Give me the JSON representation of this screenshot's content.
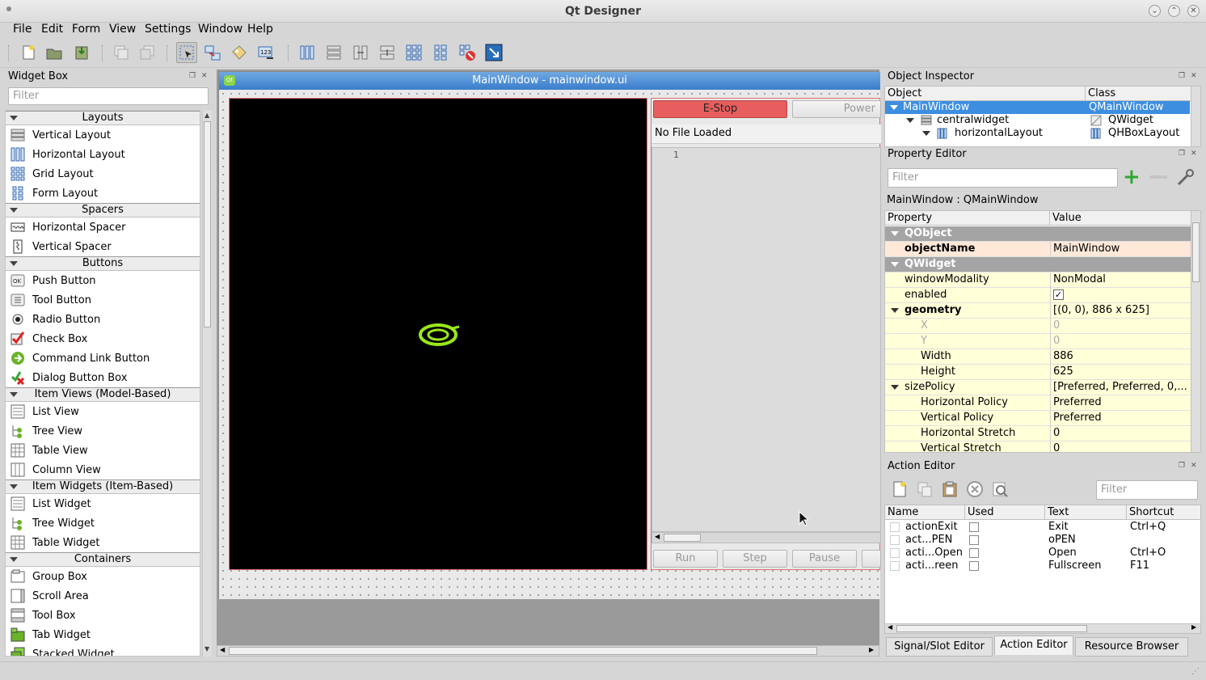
{
  "app_title": "Qt Designer",
  "menu": [
    "File",
    "Edit",
    "Form",
    "View",
    "Settings",
    "Window",
    "Help"
  ],
  "widget_box": {
    "title": "Widget Box",
    "filter_placeholder": "Filter",
    "categories": [
      {
        "name": "Layouts",
        "items": [
          "Vertical Layout",
          "Horizontal Layout",
          "Grid Layout",
          "Form Layout"
        ]
      },
      {
        "name": "Spacers",
        "items": [
          "Horizontal Spacer",
          "Vertical Spacer"
        ]
      },
      {
        "name": "Buttons",
        "items": [
          "Push Button",
          "Tool Button",
          "Radio Button",
          "Check Box",
          "Command Link Button",
          "Dialog Button Box"
        ]
      },
      {
        "name": "Item Views (Model-Based)",
        "items": [
          "List View",
          "Tree View",
          "Table View",
          "Column View"
        ]
      },
      {
        "name": "Item Widgets (Item-Based)",
        "items": [
          "List Widget",
          "Tree Widget",
          "Table Widget"
        ]
      },
      {
        "name": "Containers",
        "items": [
          "Group Box",
          "Scroll Area",
          "Tool Box",
          "Tab Widget",
          "Stacked Widget"
        ]
      }
    ]
  },
  "form": {
    "window_title": "MainWindow - mainwindow.ui",
    "estop_label": "E-Stop",
    "power_label": "Power",
    "file_status": "No File Loaded",
    "line_number": "1",
    "run_label": "Run",
    "step_label": "Step",
    "pause_label": "Pause"
  },
  "object_inspector": {
    "title": "Object Inspector",
    "col_object": "Object",
    "col_class": "Class",
    "rows": [
      {
        "object": "MainWindow",
        "class": "QMainWindow"
      },
      {
        "object": "centralwidget",
        "class": "QWidget"
      },
      {
        "object": "horizontalLayout",
        "class": "QHBoxLayout"
      }
    ]
  },
  "property_editor": {
    "title": "Property Editor",
    "filter_placeholder": "Filter",
    "context": "MainWindow : QMainWindow",
    "col_property": "Property",
    "col_value": "Value",
    "rows": [
      {
        "k": "QObject",
        "v": ""
      },
      {
        "k": "objectName",
        "v": "MainWindow"
      },
      {
        "k": "QWidget",
        "v": ""
      },
      {
        "k": "windowModality",
        "v": "NonModal"
      },
      {
        "k": "enabled",
        "v": "✓"
      },
      {
        "k": "geometry",
        "v": "[(0, 0), 886 x 625]"
      },
      {
        "k": "X",
        "v": "0"
      },
      {
        "k": "Y",
        "v": "0"
      },
      {
        "k": "Width",
        "v": "886"
      },
      {
        "k": "Height",
        "v": "625"
      },
      {
        "k": "sizePolicy",
        "v": "[Preferred, Preferred, 0,..."
      },
      {
        "k": "Horizontal Policy",
        "v": "Preferred"
      },
      {
        "k": "Vertical Policy",
        "v": "Preferred"
      },
      {
        "k": "Horizontal Stretch",
        "v": "0"
      },
      {
        "k": "Vertical Stretch",
        "v": "0"
      }
    ]
  },
  "action_editor": {
    "title": "Action Editor",
    "filter_placeholder": "Filter",
    "col_name": "Name",
    "col_used": "Used",
    "col_text": "Text",
    "col_shortcut": "Shortcut",
    "rows": [
      {
        "name": "actionExit",
        "text": "Exit",
        "shortcut": "Ctrl+Q"
      },
      {
        "name": "act...PEN",
        "text": "oPEN",
        "shortcut": ""
      },
      {
        "name": "acti...Open",
        "text": "Open",
        "shortcut": "Ctrl+O"
      },
      {
        "name": "acti...reen",
        "text": "Fullscreen",
        "shortcut": "F11"
      }
    ]
  },
  "bottom_tabs": [
    "Signal/Slot Editor",
    "Action Editor",
    "Resource Browser"
  ],
  "colors": {
    "accent": "#3a7ccb",
    "estop": "#e85e5e",
    "selection": "#3d8ee0"
  }
}
